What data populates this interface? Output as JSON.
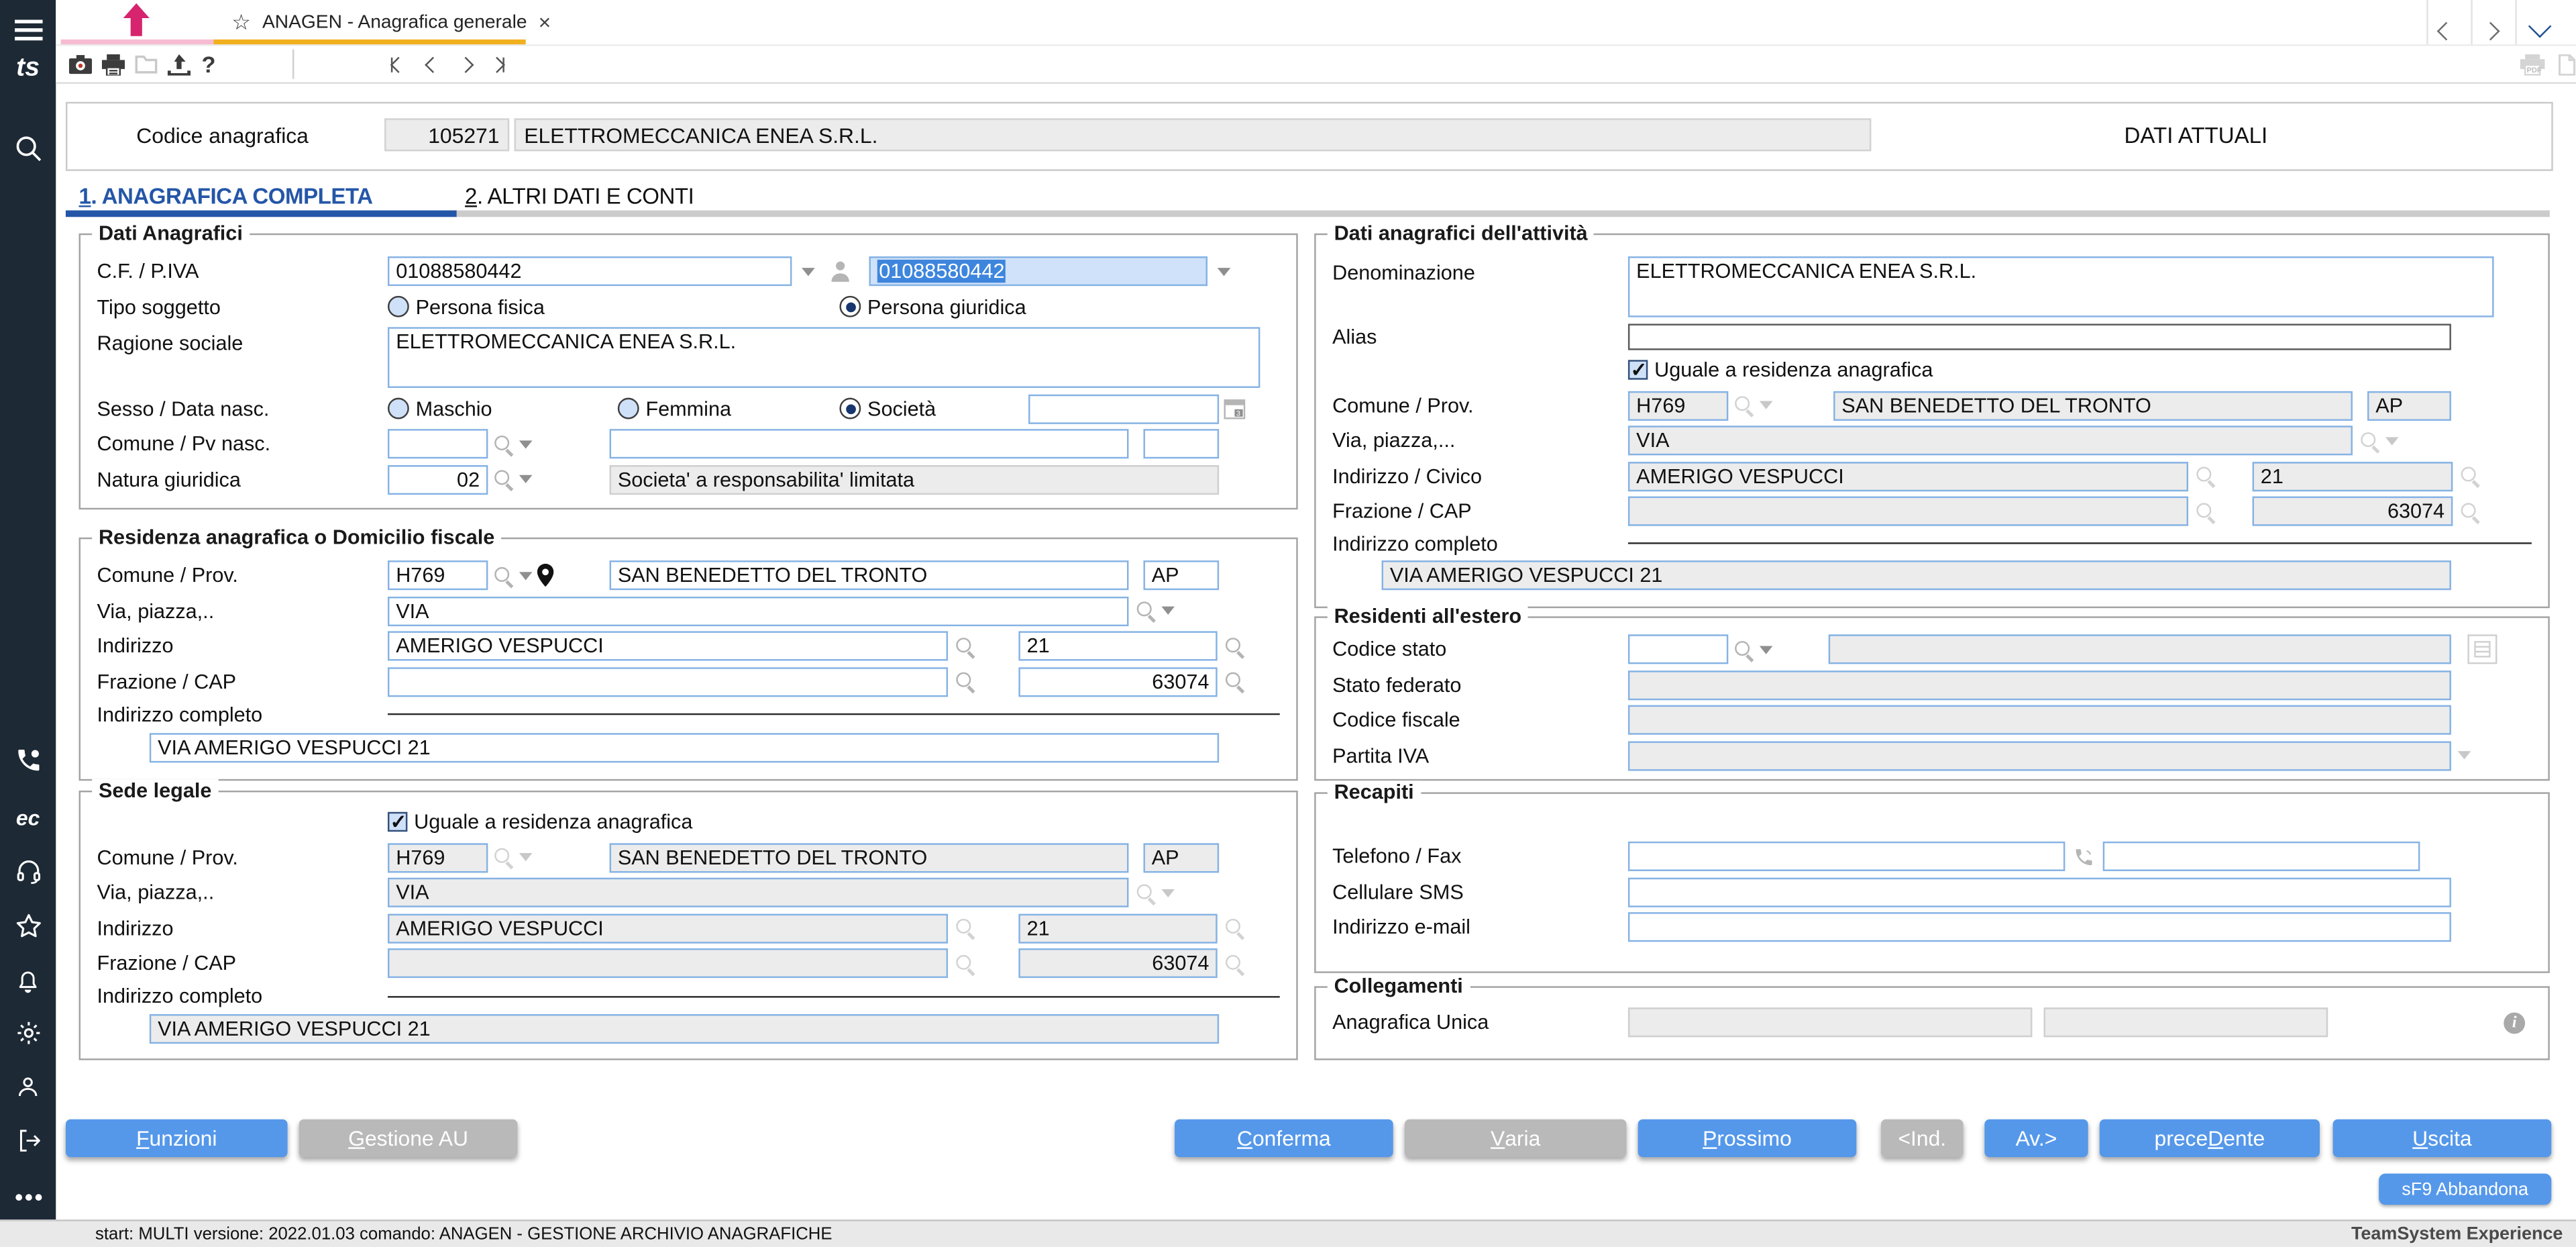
{
  "colors": {
    "accent_blue": "#5598EA",
    "tab_blue": "#2456A8",
    "tab_orange": "#F1B01F",
    "home_pink": "#D6246E",
    "sidebar_bg": "#1D2935",
    "selection_blue": "#3E86DD",
    "disabled_gray": "#ECECEC"
  },
  "chrome": {
    "tab_title": "ANAGEN - Anagrafica generale",
    "star": "☆",
    "close": "×"
  },
  "toolbar": {
    "help": "?"
  },
  "header": {
    "code_label": "Codice anagrafica",
    "code_value": "105271",
    "name_value": "ELETTROMECCANICA ENEA S.R.L.",
    "status": "DATI ATTUALI"
  },
  "tabs": {
    "t1_key": "1",
    "t1_rest": ". ANAGRAFICA COMPLETA",
    "t2_key": "2",
    "t2_rest": ". ALTRI DATI E CONTI"
  },
  "dati": {
    "legend": "Dati Anagrafici",
    "cf_label": "C.F. / P.IVA",
    "cf1": "01088580442",
    "cf2": "01088580442",
    "tipo_label": "Tipo soggetto",
    "fisica": "Persona fisica",
    "giuridica": "Persona giuridica",
    "ragione_label": "Ragione sociale",
    "ragione": "ELETTROMECCANICA ENEA S.R.L.",
    "sesso_label": "Sesso / Data nasc.",
    "maschio": "Maschio",
    "femmina": "Femmina",
    "societa": "Società",
    "comune_nasc_label": "Comune / Pv nasc.",
    "natura_label": "Natura giuridica",
    "natura_code": "02",
    "natura_desc": "Societa' a responsabilita' limitata"
  },
  "residenza": {
    "legend": "Residenza anagrafica o Domicilio fiscale",
    "comune_label": "Comune / Prov.",
    "comune_code": "H769",
    "comune": "SAN BENEDETTO DEL TRONTO",
    "prov": "AP",
    "via_label": "Via, piazza,..",
    "via": "VIA",
    "indirizzo_label": "Indirizzo",
    "indirizzo": "AMERIGO VESPUCCI",
    "civico": "21",
    "frazione_label": "Frazione / CAP",
    "frazione": "",
    "cap": "63074",
    "completo_label": "Indirizzo completo",
    "completo": "VIA AMERIGO VESPUCCI 21"
  },
  "sede": {
    "legend": "Sede legale",
    "uguale": "Uguale a residenza anagrafica",
    "comune_label": "Comune / Prov.",
    "comune_code": "H769",
    "comune": "SAN BENEDETTO DEL TRONTO",
    "prov": "AP",
    "via_label": "Via, piazza,..",
    "via": "VIA",
    "indirizzo_label": "Indirizzo",
    "indirizzo": "AMERIGO VESPUCCI",
    "civico": "21",
    "frazione_label": "Frazione / CAP",
    "frazione": "",
    "cap": "63074",
    "completo_label": "Indirizzo completo",
    "completo": "VIA AMERIGO VESPUCCI 21"
  },
  "attivita": {
    "legend": "Dati anagrafici dell'attività",
    "denominazione_label": "Denominazione",
    "denominazione": "ELETTROMECCANICA ENEA S.R.L.",
    "alias_label": "Alias",
    "alias": "",
    "uguale": "Uguale a residenza anagrafica",
    "comune_label": "Comune / Prov.",
    "comune_code": "H769",
    "comune": "SAN BENEDETTO DEL TRONTO",
    "prov": "AP",
    "via_label": "Via, piazza,...",
    "via": "VIA",
    "indirizzo_label": "Indirizzo / Civico",
    "indirizzo": "AMERIGO VESPUCCI",
    "civico": "21",
    "frazione_label": "Frazione / CAP",
    "frazione": "",
    "cap": "63074",
    "completo_label": "Indirizzo completo",
    "completo": "VIA AMERIGO VESPUCCI 21"
  },
  "estero": {
    "legend": "Residenti all'estero",
    "codice_stato_label": "Codice stato",
    "codice_stato": "",
    "stato_desc": "",
    "stato_federato_label": "Stato federato",
    "stato_federato": "",
    "codice_fiscale_label": "Codice fiscale",
    "codice_fiscale": "",
    "partita_iva_label": "Partita IVA",
    "partita_iva": ""
  },
  "recapiti": {
    "legend": "Recapiti",
    "telefono_label": "Telefono / Fax",
    "telefono": "",
    "fax": "",
    "cellulare_label": "Cellulare SMS",
    "cellulare": "",
    "email_label": "Indirizzo e-mail",
    "email": ""
  },
  "collegamenti": {
    "legend": "Collegamenti",
    "au_label": "Anagrafica Unica",
    "au1": "",
    "au2": ""
  },
  "buttons": {
    "funzioni_key": "F",
    "funzioni_rest": "unzioni",
    "gestioneau_key": "G",
    "gestioneau_rest": "estione AU",
    "conferma_key": "C",
    "conferma_rest": "onferma",
    "varia_key": "V",
    "varia_rest": "aria",
    "prossimo_key": "P",
    "prossimo_rest": "rossimo",
    "ind": "<Ind.",
    "av": "Av.>",
    "precedente_pre": "prece",
    "precedente_key": "D",
    "precedente_rest": "ente",
    "uscita_key": "U",
    "uscita_rest": "scita",
    "abbandona": "sF9 Abbandona"
  },
  "statusbar": {
    "left": "start: MULTI versione: 2022.01.03 comando: ANAGEN - GESTIONE ARCHIVIO ANAGRAFICHE",
    "right": "TeamSystem Experience"
  }
}
